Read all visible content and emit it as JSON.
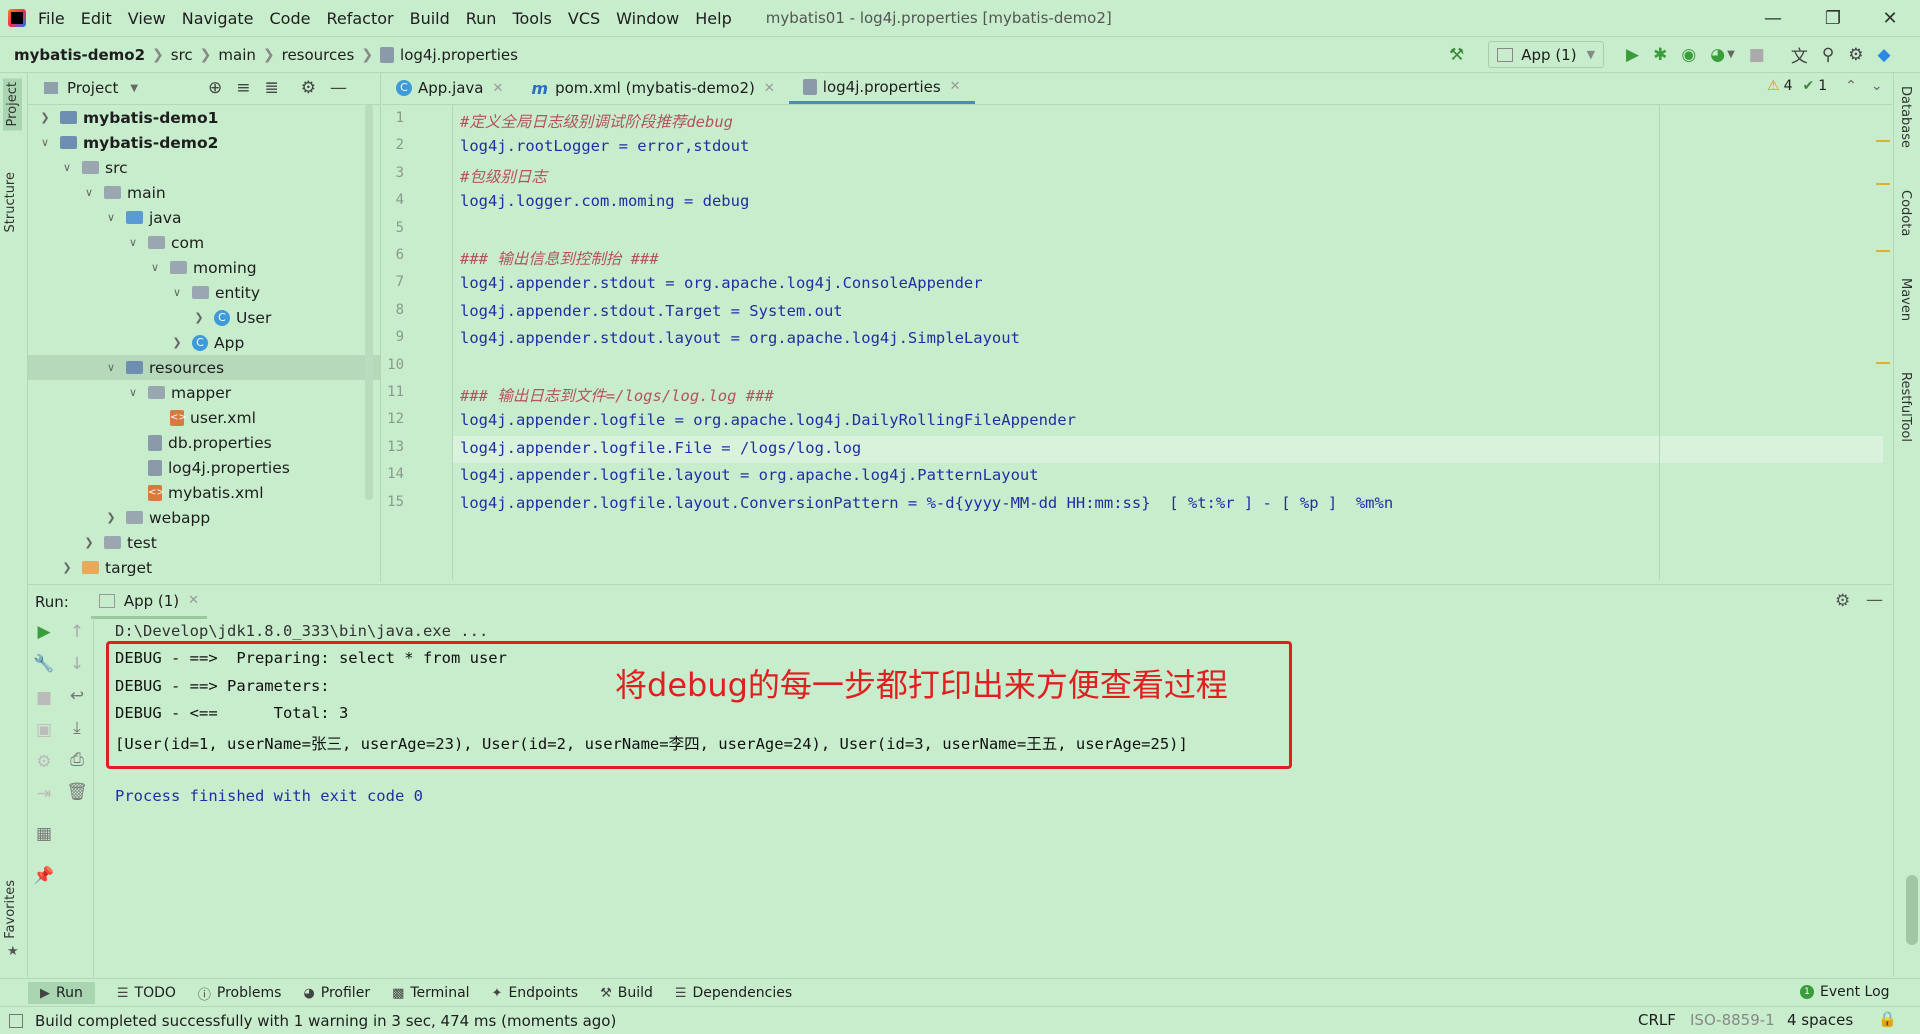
{
  "window": {
    "menu": [
      "File",
      "Edit",
      "View",
      "Navigate",
      "Code",
      "Refactor",
      "Build",
      "Run",
      "Tools",
      "VCS",
      "Window",
      "Help"
    ],
    "title": "mybatis01 - log4j.properties [mybatis-demo2]"
  },
  "breadcrumb": [
    "mybatis-demo2",
    "src",
    "main",
    "resources",
    "log4j.properties"
  ],
  "toolbar": {
    "run_config": "App (1)"
  },
  "left_stripe": {
    "project": "Project",
    "structure": "Structure",
    "favorites": "Favorites"
  },
  "right_stripe": {
    "database": "Database",
    "codota": "Codota",
    "maven": "Maven",
    "restful": "RestfulTool"
  },
  "project_panel": {
    "title": "Project"
  },
  "tree": [
    {
      "label": "mybatis-demo1",
      "level": 0,
      "arrow": "right",
      "icon": "module",
      "bold": true
    },
    {
      "label": "mybatis-demo2",
      "level": 0,
      "arrow": "down",
      "icon": "module",
      "bold": true
    },
    {
      "label": "src",
      "level": 1,
      "arrow": "down",
      "icon": "folder"
    },
    {
      "label": "main",
      "level": 2,
      "arrow": "down",
      "icon": "folder"
    },
    {
      "label": "java",
      "level": 3,
      "arrow": "down",
      "icon": "folder-blue"
    },
    {
      "label": "com",
      "level": 4,
      "arrow": "down",
      "icon": "package"
    },
    {
      "label": "moming",
      "level": 5,
      "arrow": "down",
      "icon": "package"
    },
    {
      "label": "entity",
      "level": 6,
      "arrow": "down",
      "icon": "package"
    },
    {
      "label": "User",
      "level": 7,
      "arrow": "right",
      "icon": "class"
    },
    {
      "label": "App",
      "level": 6,
      "arrow": "right",
      "icon": "class-run"
    },
    {
      "label": "resources",
      "level": 3,
      "arrow": "down",
      "icon": "folder-res",
      "selected": true
    },
    {
      "label": "mapper",
      "level": 4,
      "arrow": "down",
      "icon": "folder"
    },
    {
      "label": "user.xml",
      "level": 5,
      "arrow": "",
      "icon": "xml"
    },
    {
      "label": "db.properties",
      "level": 4,
      "arrow": "",
      "icon": "props"
    },
    {
      "label": "log4j.properties",
      "level": 4,
      "arrow": "",
      "icon": "props"
    },
    {
      "label": "mybatis.xml",
      "level": 4,
      "arrow": "",
      "icon": "xml"
    },
    {
      "label": "webapp",
      "level": 3,
      "arrow": "right",
      "icon": "folder-web"
    },
    {
      "label": "test",
      "level": 2,
      "arrow": "right",
      "icon": "folder"
    },
    {
      "label": "target",
      "level": 1,
      "arrow": "right",
      "icon": "folder-orange"
    }
  ],
  "editor_tabs": [
    {
      "label": "App.java",
      "icon": "C",
      "active": false
    },
    {
      "label": "pom.xml (mybatis-demo2)",
      "icon": "m",
      "active": false
    },
    {
      "label": "log4j.properties",
      "icon": "P",
      "active": true
    }
  ],
  "inspections": {
    "warnings": "4",
    "weak_warnings": "1"
  },
  "code_lines": [
    {
      "n": "1",
      "text": "#定义全局日志级别调试阶段推荐debug",
      "comment": true
    },
    {
      "n": "2",
      "text": "log4j.rootLogger = error,stdout",
      "comment": false
    },
    {
      "n": "3",
      "text": "#包级别日志",
      "comment": true
    },
    {
      "n": "4",
      "text": "log4j.logger.com.moming = debug",
      "comment": false
    },
    {
      "n": "5",
      "text": "",
      "comment": false
    },
    {
      "n": "6",
      "text": "### 输出信息到控制抬 ###",
      "comment": true
    },
    {
      "n": "7",
      "text": "log4j.appender.stdout = org.apache.log4j.ConsoleAppender",
      "comment": false
    },
    {
      "n": "8",
      "text": "log4j.appender.stdout.Target = System.out",
      "comment": false
    },
    {
      "n": "9",
      "text": "log4j.appender.stdout.layout = org.apache.log4j.SimpleLayout",
      "comment": false
    },
    {
      "n": "10",
      "text": "",
      "comment": false
    },
    {
      "n": "11",
      "text": "### 输出日志到文件=/logs/log.log ###",
      "comment": true
    },
    {
      "n": "12",
      "text": "log4j.appender.logfile = org.apache.log4j.DailyRollingFileAppender",
      "comment": false
    },
    {
      "n": "13",
      "text": "log4j.appender.logfile.File = /logs/log.log",
      "comment": false
    },
    {
      "n": "14",
      "text": "log4j.appender.logfile.layout = org.apache.log4j.PatternLayout",
      "comment": false
    },
    {
      "n": "15",
      "text": "log4j.appender.logfile.layout.ConversionPattern = %-d{yyyy-MM-dd HH:mm:ss}  [ %t:%r ] - [ %p ]  %m%n",
      "comment": false
    }
  ],
  "run_panel": {
    "label": "Run:",
    "tab": "App (1)"
  },
  "console": {
    "command": "D:\\Develop\\jdk1.8.0_333\\bin\\java.exe ...",
    "lines": [
      "DEBUG - ==>  Preparing: select * from user",
      "DEBUG - ==> Parameters: ",
      "DEBUG - <==      Total: 3",
      "[User(id=1, userName=张三, userAge=23), User(id=2, userName=李四, userAge=24), User(id=3, userName=王五, userAge=25)]"
    ],
    "exit": "Process finished with exit code 0"
  },
  "annotation": "将debug的每一步都打印出来方便查看过程",
  "bottom_tabs": [
    "Run",
    "TODO",
    "Problems",
    "Profiler",
    "Terminal",
    "Endpoints",
    "Build",
    "Dependencies"
  ],
  "event_log": "Event Log",
  "status": {
    "message": "Build completed successfully with 1 warning in 3 sec, 474 ms (moments ago)",
    "line_sep": "CRLF",
    "encoding": "ISO-8859-1",
    "indent": "4 spaces"
  },
  "colors": {
    "background": "#c7edcc",
    "comment": "#b4535f",
    "keyword": "#1f2fa6",
    "annotation": "#e02020"
  }
}
